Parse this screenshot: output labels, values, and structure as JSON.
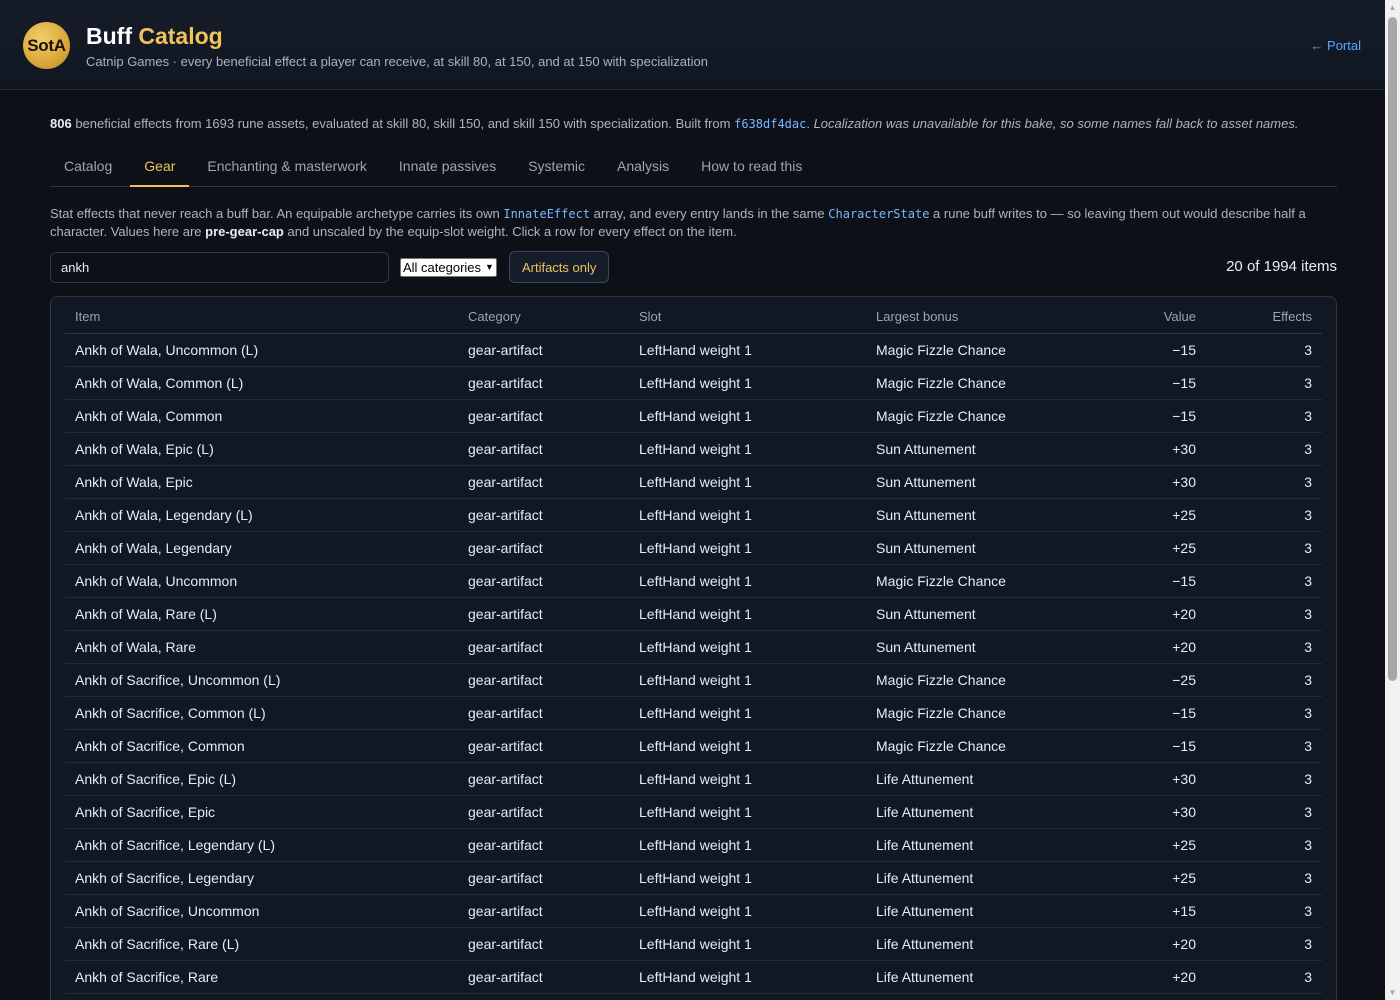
{
  "header": {
    "logo_text": "SotA",
    "title_main": "Buff",
    "title_accent": "Catalog",
    "subtitle": "Catnip Games · every beneficial effect a player can receive, at skill 80, at 150, and at 150 with specialization",
    "portal_link": "← Portal"
  },
  "summary": {
    "count": "806",
    "text1": " beneficial effects from 1693 rune assets, evaluated at skill 80, skill 150, and skill 150 with specialization. Built from ",
    "commit": "f638df4dac",
    "text2": ". ",
    "note": "Localization was unavailable for this bake, so some names fall back to asset names."
  },
  "tabs": [
    {
      "label": "Catalog"
    },
    {
      "label": "Gear"
    },
    {
      "label": "Enchanting & masterwork"
    },
    {
      "label": "Innate passives"
    },
    {
      "label": "Systemic"
    },
    {
      "label": "Analysis"
    },
    {
      "label": "How to read this"
    }
  ],
  "active_tab": "Gear",
  "description": {
    "p1": "Stat effects that never reach a buff bar. An equipable archetype carries its own ",
    "code1": "InnateEffect",
    "p2": " array, and every entry lands in the same ",
    "code2": "CharacterState",
    "p3": " a rune buff writes to — so leaving them out would describe half a character. Values here are ",
    "bold": "pre-gear-cap",
    "p4": " and unscaled by the equip-slot weight. Click a row for every effect on the item."
  },
  "controls": {
    "search_value": "ankh",
    "category_select": "All categories",
    "artifacts_button": "Artifacts only",
    "count_text": "20 of 1994 items"
  },
  "table": {
    "headers": {
      "item": "Item",
      "category": "Category",
      "slot": "Slot",
      "bonus": "Largest bonus",
      "value": "Value",
      "effects": "Effects"
    },
    "rows": [
      {
        "item": "Ankh of Wala, Uncommon (L)",
        "category": "gear-artifact",
        "slot": "LeftHand weight 1",
        "bonus": "Magic Fizzle Chance",
        "value": "−15",
        "effects": "3"
      },
      {
        "item": "Ankh of Wala, Common (L)",
        "category": "gear-artifact",
        "slot": "LeftHand weight 1",
        "bonus": "Magic Fizzle Chance",
        "value": "−15",
        "effects": "3"
      },
      {
        "item": "Ankh of Wala, Common",
        "category": "gear-artifact",
        "slot": "LeftHand weight 1",
        "bonus": "Magic Fizzle Chance",
        "value": "−15",
        "effects": "3"
      },
      {
        "item": "Ankh of Wala, Epic (L)",
        "category": "gear-artifact",
        "slot": "LeftHand weight 1",
        "bonus": "Sun Attunement",
        "value": "+30",
        "effects": "3"
      },
      {
        "item": "Ankh of Wala, Epic",
        "category": "gear-artifact",
        "slot": "LeftHand weight 1",
        "bonus": "Sun Attunement",
        "value": "+30",
        "effects": "3"
      },
      {
        "item": "Ankh of Wala, Legendary (L)",
        "category": "gear-artifact",
        "slot": "LeftHand weight 1",
        "bonus": "Sun Attunement",
        "value": "+25",
        "effects": "3"
      },
      {
        "item": "Ankh of Wala, Legendary",
        "category": "gear-artifact",
        "slot": "LeftHand weight 1",
        "bonus": "Sun Attunement",
        "value": "+25",
        "effects": "3"
      },
      {
        "item": "Ankh of Wala, Uncommon",
        "category": "gear-artifact",
        "slot": "LeftHand weight 1",
        "bonus": "Magic Fizzle Chance",
        "value": "−15",
        "effects": "3"
      },
      {
        "item": "Ankh of Wala, Rare (L)",
        "category": "gear-artifact",
        "slot": "LeftHand weight 1",
        "bonus": "Sun Attunement",
        "value": "+20",
        "effects": "3"
      },
      {
        "item": "Ankh of Wala, Rare",
        "category": "gear-artifact",
        "slot": "LeftHand weight 1",
        "bonus": "Sun Attunement",
        "value": "+20",
        "effects": "3"
      },
      {
        "item": "Ankh of Sacrifice, Uncommon (L)",
        "category": "gear-artifact",
        "slot": "LeftHand weight 1",
        "bonus": "Magic Fizzle Chance",
        "value": "−25",
        "effects": "3"
      },
      {
        "item": "Ankh of Sacrifice, Common (L)",
        "category": "gear-artifact",
        "slot": "LeftHand weight 1",
        "bonus": "Magic Fizzle Chance",
        "value": "−15",
        "effects": "3"
      },
      {
        "item": "Ankh of Sacrifice, Common",
        "category": "gear-artifact",
        "slot": "LeftHand weight 1",
        "bonus": "Magic Fizzle Chance",
        "value": "−15",
        "effects": "3"
      },
      {
        "item": "Ankh of Sacrifice, Epic (L)",
        "category": "gear-artifact",
        "slot": "LeftHand weight 1",
        "bonus": "Life Attunement",
        "value": "+30",
        "effects": "3"
      },
      {
        "item": "Ankh of Sacrifice, Epic",
        "category": "gear-artifact",
        "slot": "LeftHand weight 1",
        "bonus": "Life Attunement",
        "value": "+30",
        "effects": "3"
      },
      {
        "item": "Ankh of Sacrifice, Legendary (L)",
        "category": "gear-artifact",
        "slot": "LeftHand weight 1",
        "bonus": "Life Attunement",
        "value": "+25",
        "effects": "3"
      },
      {
        "item": "Ankh of Sacrifice, Legendary",
        "category": "gear-artifact",
        "slot": "LeftHand weight 1",
        "bonus": "Life Attunement",
        "value": "+25",
        "effects": "3"
      },
      {
        "item": "Ankh of Sacrifice, Uncommon",
        "category": "gear-artifact",
        "slot": "LeftHand weight 1",
        "bonus": "Life Attunement",
        "value": "+15",
        "effects": "3"
      },
      {
        "item": "Ankh of Sacrifice, Rare (L)",
        "category": "gear-artifact",
        "slot": "LeftHand weight 1",
        "bonus": "Life Attunement",
        "value": "+20",
        "effects": "3"
      },
      {
        "item": "Ankh of Sacrifice, Rare",
        "category": "gear-artifact",
        "slot": "LeftHand weight 1",
        "bonus": "Life Attunement",
        "value": "+20",
        "effects": "3"
      }
    ]
  },
  "colors": {
    "accent": "#f0c35a",
    "link": "#58a6ff",
    "background": "#0d1117"
  }
}
